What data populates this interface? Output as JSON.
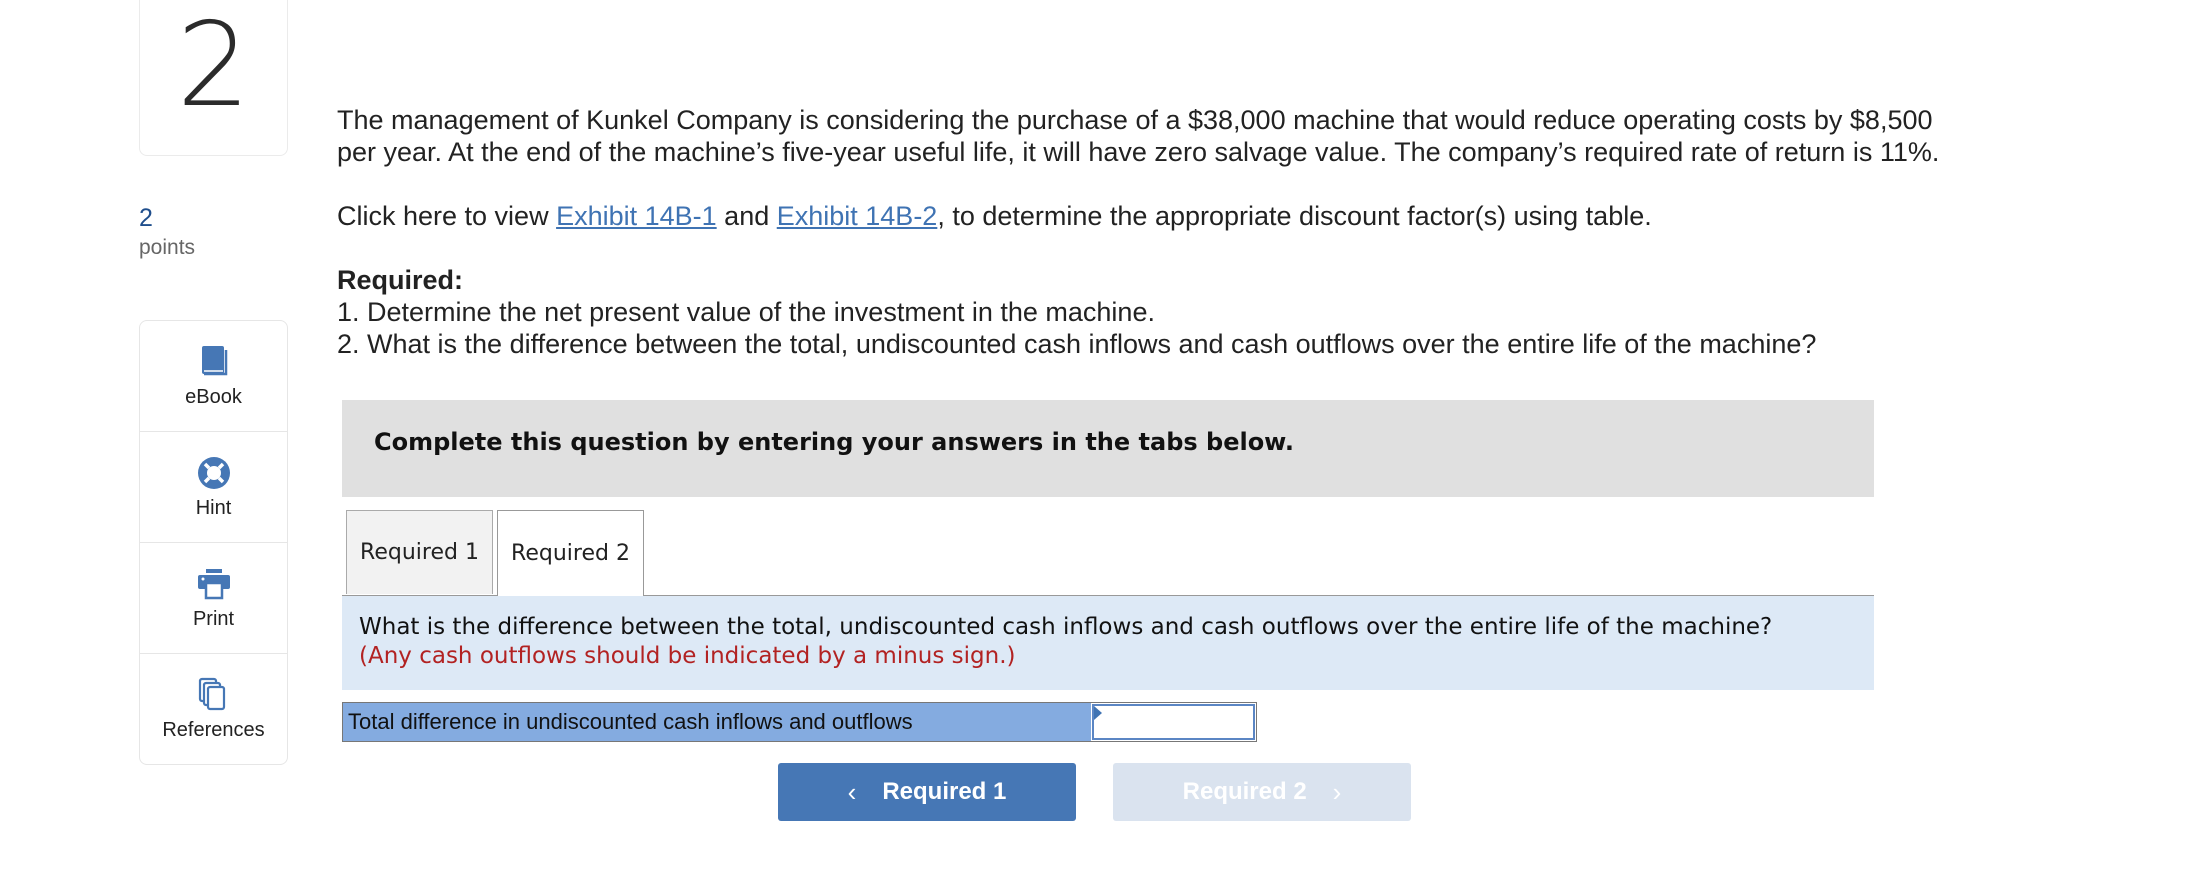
{
  "question": {
    "number": "2",
    "points_value": "2",
    "points_label": "points"
  },
  "tools": [
    {
      "label": "eBook",
      "icon": "book-icon"
    },
    {
      "label": "Hint",
      "icon": "lifebuoy-icon"
    },
    {
      "label": "Print",
      "icon": "printer-icon"
    },
    {
      "label": "References",
      "icon": "documents-icon"
    }
  ],
  "problem": {
    "line1": "The management of Kunkel Company is considering the purchase of a $38,000 machine that would reduce operating costs by $8,500",
    "line2": "per year. At the end of the machine’s five-year useful life, it will have zero salvage value. The company’s required rate of return is 11%.",
    "exhibit_prefix": "Click here to view ",
    "exhibit_link1": "Exhibit 14B-1",
    "exhibit_and": " and ",
    "exhibit_link2": "Exhibit 14B-2",
    "exhibit_suffix": ", to determine the appropriate discount factor(s) using table.",
    "required_title": "Required:",
    "required_1": "1. Determine the net present value of the investment in the machine.",
    "required_2": "2. What is the difference between the total, undiscounted cash inflows and cash outflows over the entire life of the machine?"
  },
  "instruction": "Complete this question by entering your answers in the tabs below.",
  "tabs": [
    {
      "label": "Required 1",
      "active": false
    },
    {
      "label": "Required 2",
      "active": true
    }
  ],
  "active_tab": {
    "question": "What is the difference between the total, undiscounted cash inflows and cash outflows over the entire life of the machine?",
    "note": "(Any cash outflows should be indicated by a minus sign.)",
    "row_label": "Total difference in undiscounted cash inflows and outflows",
    "input_value": ""
  },
  "nav": {
    "prev_label": "Required 1",
    "next_label": "Required 2",
    "prev_chevron": "‹",
    "next_chevron": "›"
  },
  "colors": {
    "accent": "#4677b5",
    "link": "#3f73b3",
    "question_bg": "#dde9f6",
    "answer_label_bg": "#84abe0",
    "note_red": "#b22222",
    "disabled_btn": "#dae3ef"
  }
}
